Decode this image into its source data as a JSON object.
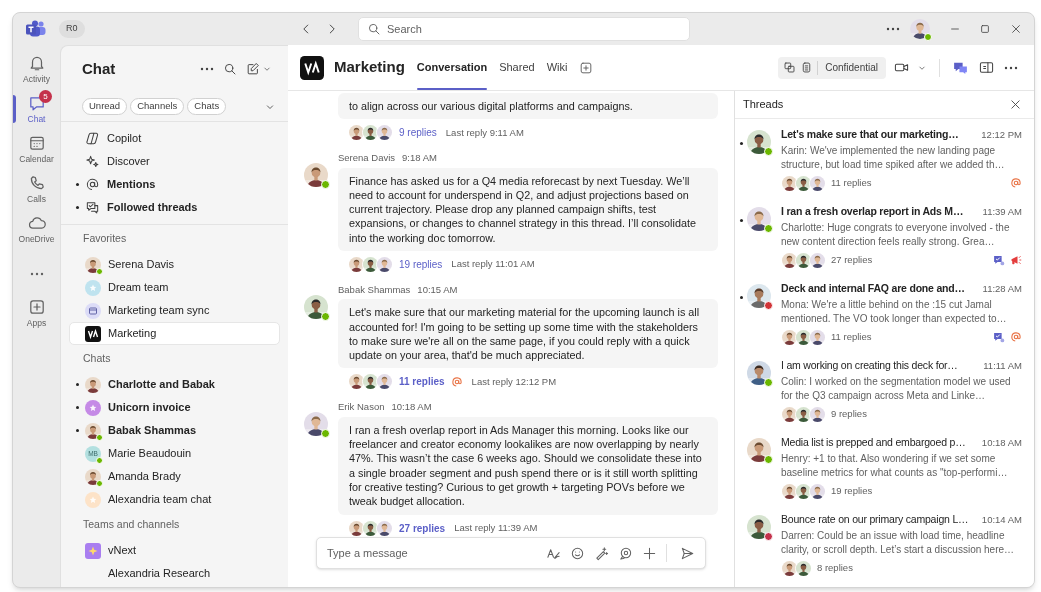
{
  "window": {
    "account_label": "R0",
    "presence": {
      "color": "#6bb700"
    }
  },
  "search": {
    "placeholder": "Search"
  },
  "rail": [
    {
      "label": "Activity",
      "kind": "bell",
      "selected": false
    },
    {
      "label": "Chat",
      "kind": "chat",
      "selected": true,
      "badge": "5"
    },
    {
      "label": "Calendar",
      "kind": "calendar",
      "selected": false
    },
    {
      "label": "Calls",
      "kind": "calls",
      "selected": false
    },
    {
      "label": "OneDrive",
      "kind": "cloud",
      "selected": false
    },
    {
      "kind": "more",
      "selected": false
    },
    {
      "label": "Apps",
      "kind": "apps",
      "selected": false
    }
  ],
  "sidebar": {
    "title": "Chat",
    "filters": [
      "Unread",
      "Channels",
      "Chats"
    ],
    "quick_links": [
      {
        "label": "Copilot",
        "kind": "copilot",
        "unread": false,
        "selected": false
      },
      {
        "label": "Discover",
        "kind": "discover",
        "unread": false,
        "selected": false
      },
      {
        "label": "Mentions",
        "kind": "mention",
        "unread": true,
        "selected": false
      },
      {
        "label": "Followed threads",
        "kind": "threads",
        "unread": true,
        "selected": false
      }
    ],
    "sections": [
      {
        "heading": "Favorites",
        "items": [
          {
            "label": "Serena Davis",
            "kind": "person",
            "presence": {
              "color": "#6bb700"
            },
            "unread": false,
            "selected": false
          },
          {
            "label": "Dream team",
            "kind": "group",
            "color": "#bfe3ef",
            "unread": false,
            "selected": false
          },
          {
            "label": "Marketing team sync",
            "kind": "meeting",
            "color": "#dcdcf7",
            "unread": false,
            "selected": false
          },
          {
            "label": "Marketing",
            "kind": "brand",
            "unread": false,
            "selected": true
          }
        ]
      },
      {
        "heading": "Chats",
        "items": [
          {
            "label": "Charlotte and Babak",
            "kind": "person",
            "unread": true,
            "selected": false
          },
          {
            "label": "Unicorn invoice",
            "kind": "group",
            "color": "#c58ae6",
            "unread": true,
            "selected": false
          },
          {
            "label": "Babak Shammas",
            "kind": "person",
            "presence": {
              "color": "#6bb700"
            },
            "unread": true,
            "selected": false
          },
          {
            "label": "Marie Beaudouin",
            "kind": "initials",
            "initials": "MB",
            "color": "#b3e0e0",
            "presence": {
              "color": "#6bb700"
            },
            "unread": false,
            "selected": false
          },
          {
            "label": "Amanda Brady",
            "kind": "person",
            "presence": {
              "color": "#6bb700"
            },
            "unread": false,
            "selected": false
          },
          {
            "label": "Alexandria team chat",
            "kind": "group",
            "color": "#fde3c8",
            "unread": false,
            "selected": false
          }
        ]
      },
      {
        "heading": "Teams and channels",
        "items": [
          {
            "label": "vNext",
            "kind": "team",
            "color": "#a97ef0",
            "unread": false,
            "selected": false
          },
          {
            "label": "Alexandria Research",
            "kind": "channel",
            "unread": false,
            "selected": false
          }
        ]
      }
    ]
  },
  "conversation": {
    "title": "Marketing",
    "tabs": [
      {
        "label": "Conversation",
        "selected": true
      },
      {
        "label": "Shared",
        "selected": false
      },
      {
        "label": "Wiki",
        "selected": false
      }
    ],
    "sensitivity": "Confidential",
    "messages": [
      {
        "text": "to align across our various digital platforms and campaigns.",
        "replies": "9 replies",
        "last_reply": "Last reply 9:11 AM",
        "unread": false,
        "mention": false,
        "repliers": [
          {
            "kind": "picture"
          },
          {
            "kind": "picture"
          },
          {
            "kind": "picture"
          }
        ]
      },
      {
        "author": "Serena Davis",
        "time": "9:18 AM",
        "presence": {
          "color": "#6bb700"
        },
        "text": "Finance has asked us for a Q4 media reforecast by next Tuesday. We’ll need to account for underspend in Q2, and adjust projections based on current trajectory. Please drop any planned campaign shifts, test expansions, or changes to channel strategy in this thread. I’ll consolidate into the working doc tomorrow.",
        "replies": "19 replies",
        "last_reply": "Last reply 11:01 AM",
        "unread": false,
        "mention": false,
        "repliers": [
          {
            "kind": "picture"
          },
          {
            "kind": "picture"
          },
          {
            "kind": "picture"
          }
        ]
      },
      {
        "author": "Babak Shammas",
        "time": "10:15 AM",
        "presence": {
          "color": "#6bb700"
        },
        "text": "Let's make sure that our marketing material for the upcoming launch is all accounted for! I'm going to be setting up some time with the stakeholders to make sure we're all on the same page, if you could reply with a quick update on your area, that'd be much appreciated.",
        "replies": "11 replies",
        "last_reply": "Last reply 12:12 PM",
        "unread": true,
        "mention": true,
        "repliers": [
          {
            "kind": "picture"
          },
          {
            "kind": "picture"
          },
          {
            "kind": "picture"
          }
        ]
      },
      {
        "author": "Erik Nason",
        "time": "10:18 AM",
        "presence": {
          "color": "#6bb700"
        },
        "text": "I ran a fresh overlap report in Ads Manager this morning. Looks like our freelancer and creator economy lookalikes are now overlapping by nearly 47%. This wasn’t the case 6 weeks ago. Should we consolidate these into a single broader segment and push spend there or is it still worth splitting for creative testing? Curious to get growth + targeting POVs before we tweak budget allocation.",
        "replies": "27 replies",
        "last_reply": "Last reply 11:39 AM",
        "unread": true,
        "mention": false,
        "repliers": [
          {
            "kind": "picture"
          },
          {
            "kind": "picture"
          },
          {
            "kind": "picture"
          }
        ]
      }
    ],
    "composer": {
      "placeholder": "Type a message"
    }
  },
  "threads": {
    "title": "Threads",
    "items": [
      {
        "title": "Let's make sure that our marketing…",
        "time": "12:12 PM",
        "preview": "Karin: We've implemented the new landing page structure, but load time spiked after we added th…",
        "replies": "11 replies",
        "unread": true,
        "presence": {
          "color": "#6bb700"
        },
        "repliers": [
          {
            "kind": "picture"
          },
          {
            "kind": "picture"
          },
          {
            "kind": "picture"
          }
        ],
        "badges": [
          {
            "kind": "mention"
          }
        ]
      },
      {
        "title": "I ran a fresh overlap report in Ads M…",
        "time": "11:39 AM",
        "preview": "Charlotte: Huge congrats to everyone involved - the new content direction feels really strong. Grea…",
        "replies": "27 replies",
        "unread": true,
        "presence": {
          "color": "#6bb700"
        },
        "repliers": [
          {
            "kind": "picture"
          },
          {
            "kind": "picture"
          },
          {
            "kind": "picture"
          }
        ],
        "badges": [
          {
            "kind": "followed"
          },
          {
            "kind": "reaction"
          }
        ]
      },
      {
        "title": "Deck and internal FAQ are done and…",
        "time": "11:28 AM",
        "preview": "Mona: We're a little behind on the :15 cut Jamal mentioned. The VO took longer than expected to…",
        "replies": "11 replies",
        "unread": true,
        "presence": {
          "color": "#d13438"
        },
        "repliers": [
          {
            "kind": "picture"
          },
          {
            "kind": "picture"
          },
          {
            "kind": "picture"
          }
        ],
        "badges": [
          {
            "kind": "followed"
          },
          {
            "kind": "mention"
          }
        ]
      },
      {
        "title": "I am working on creating this deck for…",
        "time": "11:11 AM",
        "preview": "Colin: I worked on the segmentation model we used for the Q3 campaign across Meta and Linke…",
        "replies": "9 replies",
        "unread": false,
        "presence": {
          "color": "#6bb700"
        },
        "repliers": [
          {
            "kind": "picture"
          },
          {
            "kind": "picture"
          },
          {
            "kind": "picture"
          }
        ]
      },
      {
        "title": "Media list is prepped and embargoed p…",
        "time": "10:18 AM",
        "preview": "Henry: +1 to that. Also wondering if we set some baseline metrics for what counts as \"top-performi…",
        "replies": "19 replies",
        "unread": false,
        "presence": {
          "color": "#6bb700"
        },
        "repliers": [
          {
            "kind": "picture"
          },
          {
            "kind": "picture"
          },
          {
            "kind": "picture"
          }
        ]
      },
      {
        "title": "Bounce rate on our primary campaign L…",
        "time": "10:14 AM",
        "preview": "Darren: Could be an issue with load time, headline clarity, or scroll depth. Let’s start a discussion here…",
        "replies": "8 replies",
        "unread": false,
        "presence": {
          "color": "#c4314b"
        },
        "repliers": [
          {
            "kind": "picture"
          },
          {
            "kind": "picture"
          }
        ]
      }
    ]
  }
}
